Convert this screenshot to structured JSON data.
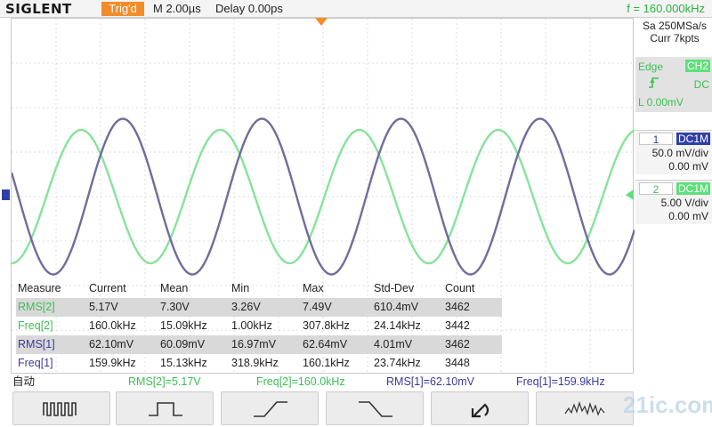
{
  "header": {
    "brand": "SIGLENT",
    "trigger_status": "Trig'd",
    "timebase": "M 2.00µs",
    "delay": "Delay 0.00ps",
    "frequency": "f = 160.000kHz"
  },
  "acquisition": {
    "sample_rate": "Sa 250MSa/s",
    "memory": "Curr 7kpts"
  },
  "trigger": {
    "type": "Edge",
    "source": "CH2",
    "slope_icon": "rising-edge-icon",
    "coupling": "DC",
    "level": "L  0.00mV"
  },
  "channels": [
    {
      "number": "1",
      "coupling": "DC1M",
      "scale": "50.0 mV/div",
      "offset": "0.00 mV",
      "color": "#3a3a9a"
    },
    {
      "number": "2",
      "coupling": "DC1M",
      "scale": "5.00 V/div",
      "offset": "0.00 mV",
      "color": "#5ee07a"
    }
  ],
  "measurements": {
    "headers": [
      "Measure",
      "Current",
      "Mean",
      "Min",
      "Max",
      "Std-Dev",
      "Count"
    ],
    "rows": [
      [
        "RMS[2]",
        "5.17V",
        "7.30V",
        "3.26V",
        "7.49V",
        "610.4mV",
        "3462"
      ],
      [
        "Freq[2]",
        "160.0kHz",
        "15.09kHz",
        "1.00kHz",
        "307.8kHz",
        "24.14kHz",
        "3442"
      ],
      [
        "RMS[1]",
        "62.10mV",
        "60.09mV",
        "16.97mV",
        "62.64mV",
        "4.01mV",
        "3462"
      ],
      [
        "Freq[1]",
        "159.9kHz",
        "15.13kHz",
        "318.9kHz",
        "160.1kHz",
        "23.74kHz",
        "3448"
      ]
    ]
  },
  "status_bar": {
    "mode": "自动",
    "items": [
      "RMS[2]=5.17V",
      "Freq[2]=160.0kHz",
      "RMS[1]=62.10mV",
      "Freq[1]=159.9kHz"
    ]
  },
  "softkeys": [
    {
      "icon": "pulse-train-icon"
    },
    {
      "icon": "pulse-icon"
    },
    {
      "icon": "rising-edge-icon"
    },
    {
      "icon": "falling-edge-icon"
    },
    {
      "icon": "undo-icon"
    },
    {
      "icon": "signal-noise-icon"
    }
  ],
  "waveforms": {
    "ch1": {
      "color": "#706c9c",
      "amplitude_div": 1.75,
      "period_div": 3.125,
      "phase_deg": 162
    },
    "ch2": {
      "color": "#86e39a",
      "amplitude_div": 1.5,
      "period_div": 3.125,
      "phase_deg": 270
    }
  },
  "watermark": "21ic.com"
}
